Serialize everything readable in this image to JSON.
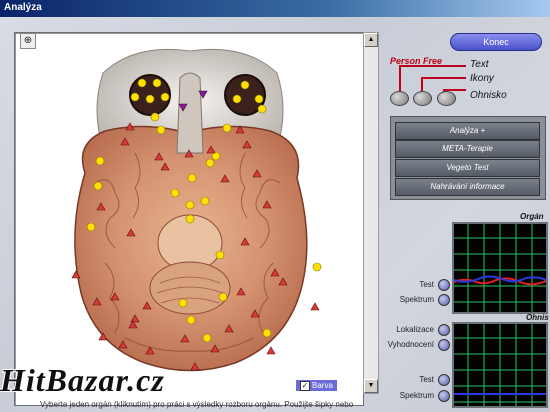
{
  "window": {
    "title": "Analýza"
  },
  "viewer": {
    "zoom_icon": "magnifier-icon",
    "colors": {
      "marker_circle": "#ffe000",
      "marker_triangle": "#d83a3a",
      "marker_triangle_purple": "#8a1a9a"
    },
    "barva_label": "Barva",
    "barva_checked": true,
    "footer_text": "Vyberte jeden orgán (kliknutím) pro práci s výsledky rozboru orgánu. Použijte šipky nebo"
  },
  "controls": {
    "konec": "Konec",
    "person_free": "Person Free",
    "modes": [
      "Text",
      "Ikony",
      "Ohnisko"
    ]
  },
  "menu": {
    "items": [
      "Analýza +",
      "META-Terapie",
      "Vegeto Test",
      "Nahrávání informace"
    ]
  },
  "scopes": {
    "organ_title": "Orgán",
    "ohnisko_title": "Ohnis",
    "organ_labels": [
      "Test",
      "Spektrum"
    ],
    "ohnisko_labels": [
      "Lokalizace",
      "Vyhodnocení",
      "Test",
      "Spektrum"
    ],
    "colors": {
      "grid": "#2ec95a",
      "trace_red": "#e02020",
      "trace_blue": "#2a3ae0"
    }
  },
  "watermark": "HitBazar.cz"
}
